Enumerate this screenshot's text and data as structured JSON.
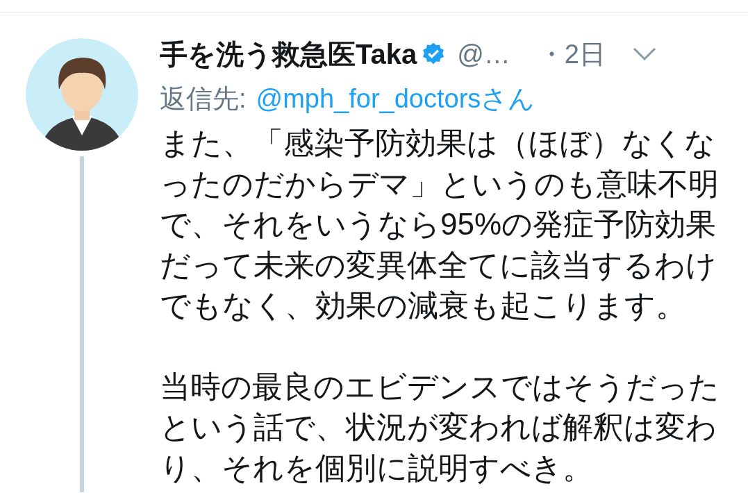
{
  "tweet": {
    "author": "手を洗う救急医Taka",
    "verified": true,
    "handle": "@…",
    "time": "・2日",
    "reply_label": "返信先:",
    "reply_to": "@mph_for_doctorsさん",
    "paragraphs": [
      "また、「感染予防効果は（ほぼ）なくなったのだからデマ」というのも意味不明で、それをいうなら95%の発症予防効果だって未来の変異体全てに該当するわけでもなく、効果の減衰も起こります。",
      "当時の最良のエビデンスではそうだったという話で、状況が変われば解釈は変わり、それを個別に説明すべき。"
    ]
  }
}
